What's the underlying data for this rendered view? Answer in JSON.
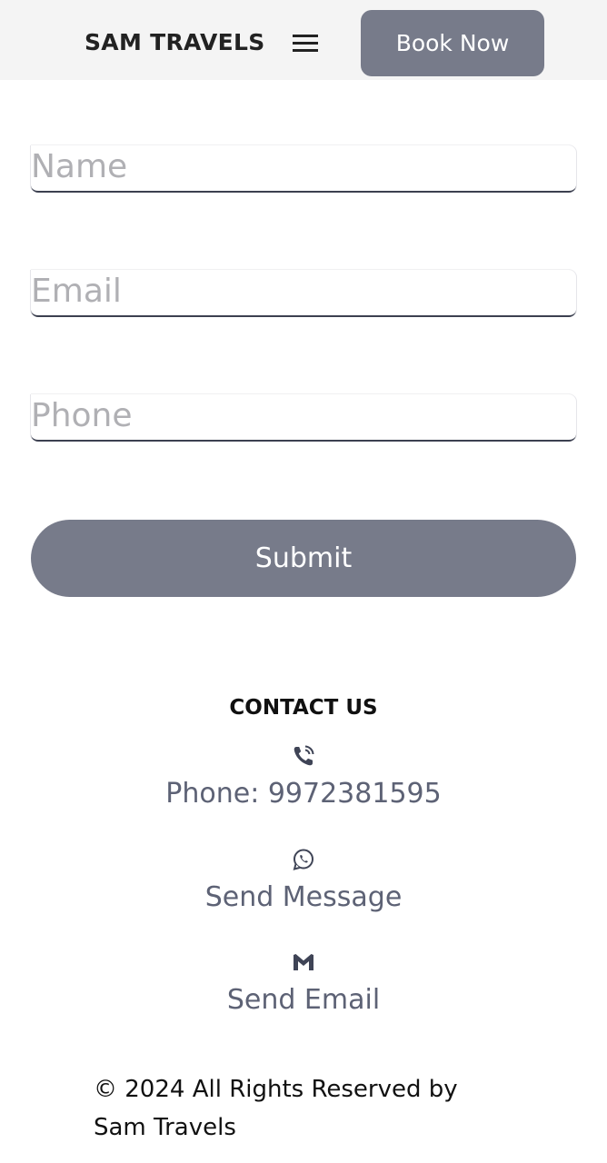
{
  "header": {
    "brand": "SAM TRAVELS",
    "menu_icon": "hamburger-icon",
    "book_label": "Book Now"
  },
  "form": {
    "name_placeholder": "Name",
    "email_placeholder": "Email",
    "phone_placeholder": "Phone",
    "submit_label": "Submit"
  },
  "contact": {
    "title": "CONTACT US",
    "items": [
      {
        "icon": "phone-icon",
        "label": "Phone: 9972381595"
      },
      {
        "icon": "whatsapp-icon",
        "label": "Send Message"
      },
      {
        "icon": "gmail-icon",
        "label": "Send Email"
      }
    ]
  },
  "footer": {
    "copyright_line1": "© 2024 All Rights Reserved by",
    "copyright_line2": "Sam Travels"
  },
  "colors": {
    "header_bg": "#f4f4f4",
    "button_bg": "#777b8a",
    "contact_text": "#5d6275"
  }
}
